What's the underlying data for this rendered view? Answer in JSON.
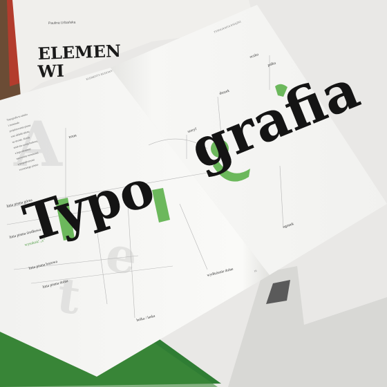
{
  "background_book": {
    "author": "Paulina Urbańska",
    "title_line_1": "ELEMEN",
    "title_line_2": "WI"
  },
  "spread": {
    "running_head_left": "ELEMENTY BUDOWY",
    "running_head_right": "TYPOGRAFIA KSIĄŻKI",
    "hero_left": "Typo",
    "hero_right": "grafia",
    "left_labels": {
      "linia_pisma_gorna": "linia pisma górna",
      "linia_pisma_srodkowa": "linia pisma środkowa",
      "wysokosc_x": "wysokość „x”",
      "linia_pisma_bazowa": "linia pisma bazowa",
      "linia_pisma_dolna": "linia pisma dolna",
      "trzon": "trzon",
      "belka_laska": "belka / laska",
      "wydluzenie_dolne": "wydłużenie dolne"
    },
    "right_labels": {
      "szeryf": "szeryf",
      "daszek": "daszek",
      "oczko": "oczko",
      "palka": "pałka",
      "ogonek": "ogonek"
    },
    "page_number": "16",
    "body_text": [
      "Typografia to sztuka",
      "i rzemiosło",
      "projektowania pisma",
      "oraz układu tekstu",
      "na stronie. Każdy",
      "znak ma swoją budowę,",
      "a jego elementy",
      "nazywamy terminami",
      "typograficznymi",
      "wyrazistego pisma."
    ]
  },
  "colors": {
    "accent_green": "#6cb85c",
    "ink": "#141414",
    "page": "#f6f6f4",
    "green_edge": "#3f8a3a"
  }
}
